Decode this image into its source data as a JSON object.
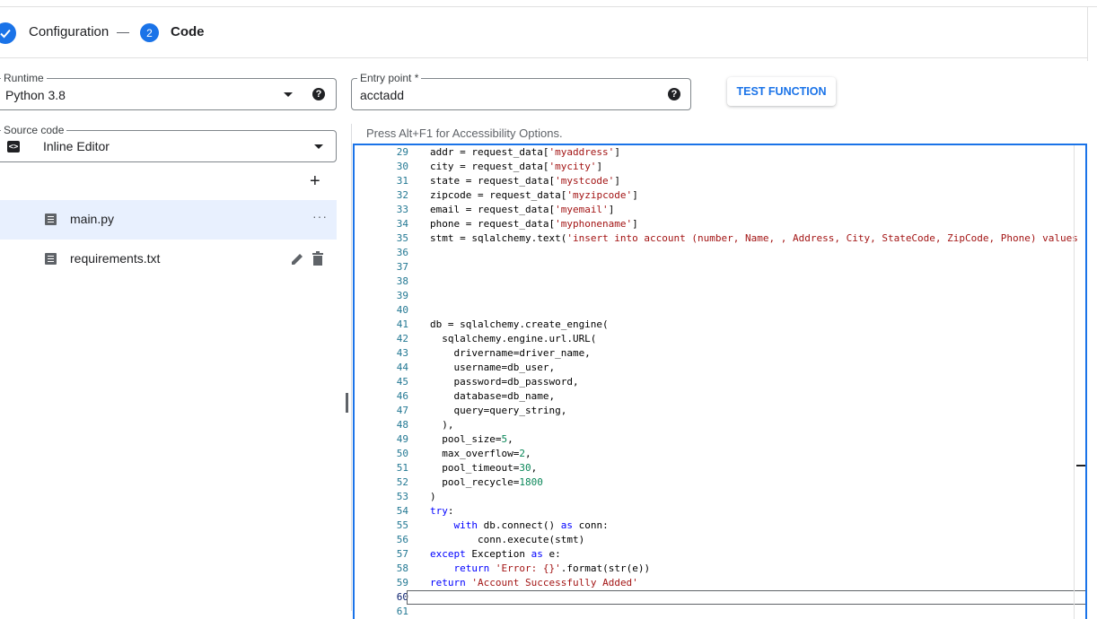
{
  "stepper": {
    "step1": {
      "label": "Configuration",
      "done": true
    },
    "step2": {
      "number": "2",
      "label": "Code"
    }
  },
  "runtime": {
    "label": "Runtime",
    "value": "Python 3.8",
    "icon": "help-icon"
  },
  "entry_point": {
    "label": "Entry point *",
    "value": "acctadd",
    "icon": "help-icon"
  },
  "test_button": {
    "label": "TEST FUNCTION"
  },
  "source_code": {
    "label": "Source code",
    "value": "Inline Editor",
    "icon": "code-icon"
  },
  "files": [
    {
      "name": "main.py",
      "active": true,
      "actions": "···"
    },
    {
      "name": "requirements.txt",
      "active": false,
      "actions": [
        "edit-icon",
        "delete-icon"
      ]
    }
  ],
  "editor": {
    "a11y_hint": "Press Alt+F1 for Accessibility Options.",
    "lines": [
      {
        "n": "29",
        "html": "addr = request_data[<span class='str'>'myaddress'</span>]"
      },
      {
        "n": "30",
        "html": "city = request_data[<span class='str'>'mycity'</span>]"
      },
      {
        "n": "31",
        "html": "state = request_data[<span class='str'>'mystcode'</span>]"
      },
      {
        "n": "32",
        "html": "zipcode = request_data[<span class='str'>'myzipcode'</span>]"
      },
      {
        "n": "33",
        "html": "email = request_data[<span class='str'>'myemail'</span>]"
      },
      {
        "n": "34",
        "html": "phone = request_data[<span class='str'>'myphonename'</span>]"
      },
      {
        "n": "35",
        "html": "stmt = sqlalchemy.text(<span class='str'>'insert into account (number, Name, , Address, City, StateCode, ZipCode, Phone) values (</span>"
      },
      {
        "n": "36",
        "html": ""
      },
      {
        "n": "37",
        "html": ""
      },
      {
        "n": "38",
        "html": ""
      },
      {
        "n": "39",
        "html": ""
      },
      {
        "n": "40",
        "html": ""
      },
      {
        "n": "41",
        "html": "db = sqlalchemy.create_engine("
      },
      {
        "n": "42",
        "html": "  sqlalchemy.engine.url.URL("
      },
      {
        "n": "43",
        "html": "    drivername=driver_name,"
      },
      {
        "n": "44",
        "html": "    username=db_user,"
      },
      {
        "n": "45",
        "html": "    password=db_password,"
      },
      {
        "n": "46",
        "html": "    database=db_name,"
      },
      {
        "n": "47",
        "html": "    query=query_string,"
      },
      {
        "n": "48",
        "html": "  ),"
      },
      {
        "n": "49",
        "html": "  pool_size=<span class='num'>5</span>,"
      },
      {
        "n": "50",
        "html": "  max_overflow=<span class='num'>2</span>,"
      },
      {
        "n": "51",
        "html": "  pool_timeout=<span class='num'>30</span>,"
      },
      {
        "n": "52",
        "html": "  pool_recycle=<span class='num'>1800</span>"
      },
      {
        "n": "53",
        "html": ")"
      },
      {
        "n": "54",
        "html": "<span class='kw'>try</span>:"
      },
      {
        "n": "55",
        "html": "    <span class='kw'>with</span> db.connect() <span class='kw'>as</span> conn:"
      },
      {
        "n": "56",
        "html": "        conn.execute(stmt)"
      },
      {
        "n": "57",
        "html": "<span class='kw'>except</span> Exception <span class='kw'>as</span> e:"
      },
      {
        "n": "58",
        "html": "    <span class='kw'>return</span> <span class='str'>'Error: {}'</span>.format(str(e))"
      },
      {
        "n": "59",
        "html": "<span class='kw'>return</span> <span class='str'>'Account Successfully Added'</span>"
      },
      {
        "n": "60",
        "html": ""
      },
      {
        "n": "61",
        "html": ""
      }
    ],
    "current_line": "60"
  }
}
